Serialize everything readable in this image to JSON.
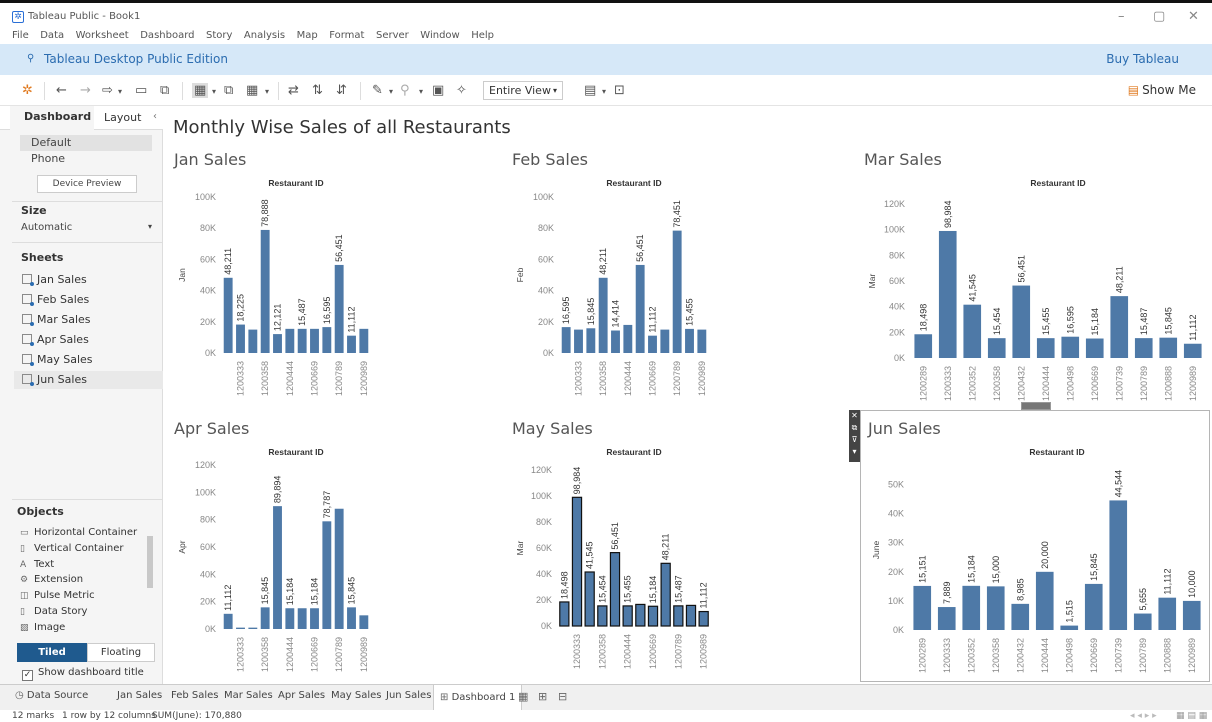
{
  "window": {
    "title": "Tableau Public - Book1",
    "minimize_icon": "minimize-icon",
    "maximize_icon": "maximize-icon",
    "close_icon": "close-icon"
  },
  "menu": [
    "File",
    "Data",
    "Worksheet",
    "Dashboard",
    "Story",
    "Analysis",
    "Map",
    "Format",
    "Server",
    "Window",
    "Help"
  ],
  "banner": {
    "edition": "Tableau Desktop Public Edition",
    "buy": "Buy Tableau",
    "text_color": "#2b6cb0",
    "bg_color": "#d6e8f8"
  },
  "toolbar": {
    "fit": "Entire View",
    "show_me": "Show Me"
  },
  "left_panel": {
    "tabs": [
      "Dashboard",
      "Layout"
    ],
    "devices": [
      "Default",
      "Phone"
    ],
    "device_preview": "Device Preview",
    "size_header": "Size",
    "size_value": "Automatic",
    "sheets_header": "Sheets",
    "sheets": [
      "Jan Sales",
      "Feb Sales",
      "Mar Sales",
      "Apr Sales",
      "May Sales",
      "Jun Sales"
    ],
    "objects_header": "Objects",
    "objects": [
      {
        "label": "Horizontal Container",
        "icon": "horizontal-container-icon"
      },
      {
        "label": "Vertical Container",
        "icon": "vertical-container-icon"
      },
      {
        "label": "Text",
        "icon": "text-icon"
      },
      {
        "label": "Extension",
        "icon": "extension-icon"
      },
      {
        "label": "Pulse Metric",
        "icon": "pulse-metric-icon"
      },
      {
        "label": "Data Story",
        "icon": "data-story-icon"
      },
      {
        "label": "Image",
        "icon": "image-icon"
      }
    ],
    "tiled": "Tiled",
    "floating": "Floating",
    "show_title": "Show dashboard title",
    "show_title_checked": true
  },
  "dashboard": {
    "title": "Monthly Wise Sales of all Restaurants"
  },
  "chart_data": [
    {
      "type": "bar",
      "title": "Jan Sales",
      "header": "Restaurant ID",
      "ylabel": "Jan",
      "ylim": [
        0,
        100000
      ],
      "yticks": [
        0,
        20000,
        40000,
        60000,
        80000,
        100000
      ],
      "ytick_labels": [
        "0K",
        "20K",
        "40K",
        "60K",
        "80K",
        "100K"
      ],
      "x_tick_labels": [
        "",
        "1200333",
        "",
        "1200358",
        "",
        "1200444",
        "",
        "1200669",
        "",
        "1200789",
        "",
        "1200989"
      ],
      "values": [
        48211,
        18225,
        15000,
        78888,
        12121,
        15487,
        15487,
        15487,
        16595,
        56451,
        11112,
        15487
      ],
      "data_labels": [
        "48,211",
        "18,225",
        "",
        "78,888",
        "12,121",
        "",
        "15,487",
        "",
        "16,595",
        "56,451",
        "11,112",
        ""
      ],
      "bar_color": "#4e79a7"
    },
    {
      "type": "bar",
      "title": "Feb Sales",
      "header": "Restaurant ID",
      "ylabel": "Feb",
      "ylim": [
        0,
        100000
      ],
      "yticks": [
        0,
        20000,
        40000,
        60000,
        80000,
        100000
      ],
      "ytick_labels": [
        "0K",
        "20K",
        "40K",
        "60K",
        "80K",
        "100K"
      ],
      "x_tick_labels": [
        "",
        "1200333",
        "",
        "1200358",
        "",
        "1200444",
        "",
        "1200669",
        "",
        "1200789",
        "",
        "1200989"
      ],
      "values": [
        16595,
        15000,
        15845,
        48211,
        14414,
        18000,
        56451,
        11112,
        15000,
        78451,
        15455,
        15000
      ],
      "data_labels": [
        "16,595",
        "",
        "15,845",
        "48,211",
        "14,414",
        "",
        "56,451",
        "11,112",
        "",
        "78,451",
        "15,455",
        ""
      ],
      "bar_color": "#4e79a7"
    },
    {
      "type": "bar",
      "title": "Mar Sales",
      "header": "Restaurant ID",
      "ylabel": "Mar",
      "ylim": [
        0,
        120000
      ],
      "yticks": [
        0,
        20000,
        40000,
        60000,
        80000,
        100000,
        120000
      ],
      "ytick_labels": [
        "0K",
        "20K",
        "40K",
        "60K",
        "80K",
        "100K",
        "120K"
      ],
      "x_tick_labels": [
        "1200289",
        "1200333",
        "1200352",
        "1200358",
        "1200432",
        "1200444",
        "1200498",
        "1200669",
        "1200739",
        "1200789",
        "1200888",
        "1200989"
      ],
      "values": [
        18498,
        98984,
        41545,
        15454,
        56451,
        15455,
        16595,
        15184,
        48211,
        15487,
        15845,
        11112
      ],
      "data_labels": [
        "18,498",
        "98,984",
        "41,545",
        "15,454",
        "56,451",
        "15,455",
        "16,595",
        "15,184",
        "48,211",
        "15,487",
        "15,845",
        "11,112"
      ],
      "bar_color": "#4e79a7"
    },
    {
      "type": "bar",
      "title": "Apr Sales",
      "header": "Restaurant ID",
      "ylabel": "Apr",
      "ylim": [
        0,
        120000
      ],
      "yticks": [
        0,
        20000,
        40000,
        60000,
        80000,
        100000,
        120000
      ],
      "ytick_labels": [
        "0K",
        "20K",
        "40K",
        "60K",
        "80K",
        "100K",
        "120K"
      ],
      "x_tick_labels": [
        "",
        "1200333",
        "",
        "1200358",
        "",
        "1200444",
        "",
        "1200669",
        "",
        "1200789",
        "",
        "1200989"
      ],
      "values": [
        11112,
        1000,
        1000,
        15845,
        89894,
        15184,
        15184,
        15184,
        78787,
        88000,
        15845,
        10000
      ],
      "data_labels": [
        "11,112",
        "",
        "",
        "15,845",
        "89,894",
        "15,184",
        "",
        "15,184",
        "78,787",
        "",
        "15,845",
        ""
      ],
      "bar_color": "#4e79a7"
    },
    {
      "type": "bar",
      "title": "May Sales",
      "header": "Restaurant ID",
      "ylabel": "Mar",
      "ylim": [
        0,
        120000
      ],
      "yticks": [
        0,
        20000,
        40000,
        60000,
        80000,
        100000,
        120000
      ],
      "ytick_labels": [
        "0K",
        "20K",
        "40K",
        "60K",
        "80K",
        "100K",
        "120K"
      ],
      "x_tick_labels": [
        "",
        "1200333",
        "",
        "1200358",
        "",
        "1200444",
        "",
        "1200669",
        "",
        "1200789",
        "",
        "1200989"
      ],
      "values": [
        18498,
        98984,
        41545,
        15454,
        56451,
        15455,
        16595,
        15184,
        48211,
        15487,
        15845,
        11112
      ],
      "data_labels": [
        "18,498",
        "98,984",
        "41,545",
        "15,454",
        "56,451",
        "15,455",
        "",
        "15,184",
        "48,211",
        "15,487",
        "",
        "11,112"
      ],
      "bar_color": "#4e79a7",
      "selected": true
    },
    {
      "type": "bar",
      "title": "Jun Sales",
      "header": "Restaurant ID",
      "ylabel": "June",
      "ylim": [
        0,
        55000
      ],
      "yticks": [
        0,
        10000,
        20000,
        30000,
        40000,
        50000
      ],
      "ytick_labels": [
        "0K",
        "10K",
        "20K",
        "30K",
        "40K",
        "50K"
      ],
      "x_tick_labels": [
        "1200289",
        "1200333",
        "1200352",
        "1200358",
        "1200432",
        "1200444",
        "1200498",
        "1200669",
        "1200739",
        "1200789",
        "1200888",
        "1200989"
      ],
      "values": [
        15151,
        7889,
        15184,
        15000,
        8985,
        20000,
        1515,
        15845,
        44544,
        5655,
        11112,
        10000
      ],
      "data_labels": [
        "15,151",
        "7,889",
        "15,184",
        "15,000",
        "8,985",
        "20,000",
        "1,515",
        "15,845",
        "44,544",
        "5,655",
        "11,112",
        "10,000"
      ],
      "bar_color": "#4e79a7"
    }
  ],
  "sheet_tabs": [
    "Data Source",
    "Jan Sales",
    "Feb Sales",
    "Mar Sales",
    "Apr Sales",
    "May Sales",
    "Jun Sales",
    "Dashboard 1"
  ],
  "status": {
    "marks": "12 marks",
    "rows_cols": "1 row by 12 columns",
    "sum": "SUM(June): 170,880"
  }
}
